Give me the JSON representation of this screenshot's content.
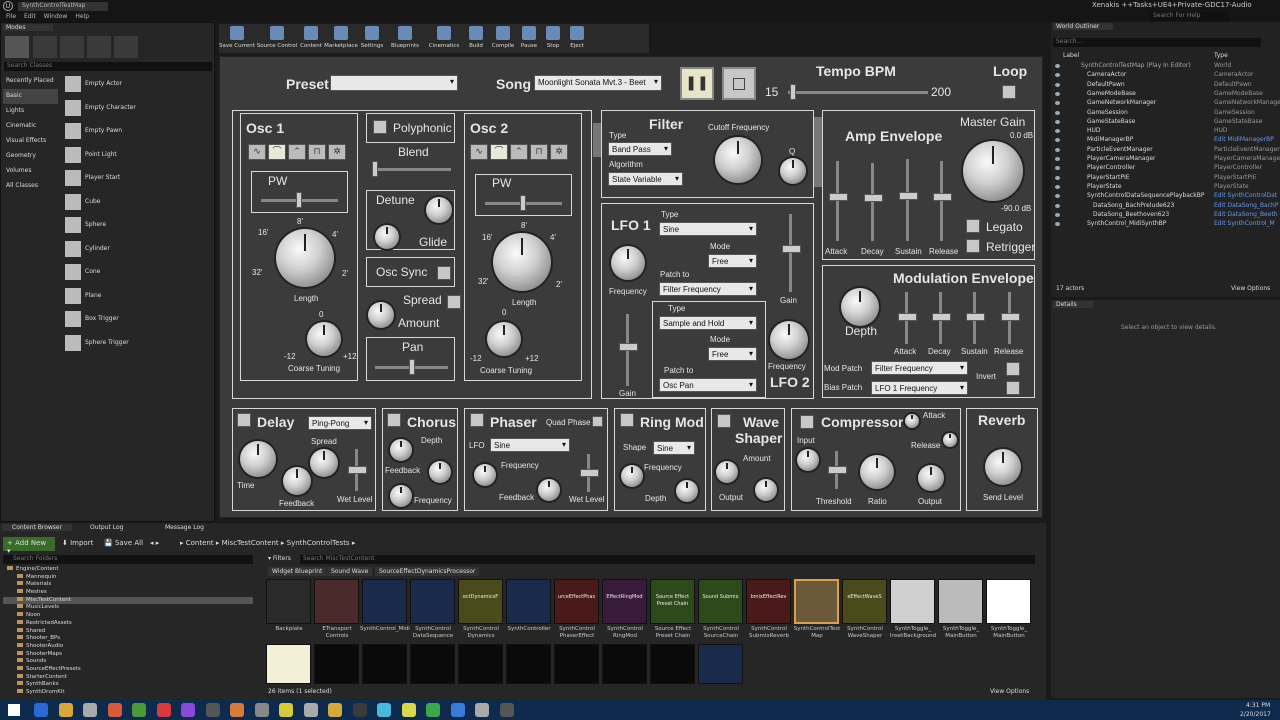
{
  "window": {
    "title": "Xenakis ++Tasks+UE4+Private-GDC17-Audio",
    "search_help": "Search For Help",
    "menu": [
      "File",
      "Edit",
      "Window",
      "Help"
    ],
    "tab": "SynthControlTestMap"
  },
  "modes": {
    "tab": "Modes",
    "search_placeholder": "Search Classes",
    "categories": [
      "Recently Placed",
      "Basic",
      "Lights",
      "Cinematic",
      "Visual Effects",
      "Geometry",
      "Volumes",
      "All Classes"
    ],
    "items": [
      "Empty Actor",
      "Empty Character",
      "Empty Pawn",
      "Point Light",
      "Player Start",
      "Cube",
      "Sphere",
      "Cylinder",
      "Cone",
      "Plane",
      "Box Trigger",
      "Sphere Trigger"
    ]
  },
  "toolbar": {
    "buttons": [
      "Save Current",
      "Source Control",
      "Content",
      "Marketplace",
      "Settings",
      "Blueprints",
      "Cinematics",
      "Build",
      "Compile",
      "Pause",
      "Stop",
      "Eject"
    ]
  },
  "synth": {
    "preset_label": "Preset",
    "preset_value": "",
    "song_label": "Song",
    "song_value": "Moonlight Sonata Mvt.3 - Beet",
    "tempo_label": "Tempo BPM",
    "tempo_min": "15",
    "tempo_max": "200",
    "loop_label": "Loop",
    "osc1": {
      "title": "Osc 1",
      "pw": "PW",
      "tick_8": "8'",
      "tick_16": "16'",
      "tick_4": "4'",
      "tick_32": "32'",
      "tick_2": "2'",
      "length": "Length",
      "zero": "0",
      "neg12": "-12",
      "pos12": "+12",
      "coarse": "Coarse Tuning"
    },
    "poly": {
      "polyphonic": "Polyphonic",
      "blend": "Blend",
      "detune": "Detune",
      "glide": "Glide",
      "osc_sync": "Osc Sync",
      "spread": "Spread",
      "amount": "Amount",
      "pan": "Pan"
    },
    "osc2": {
      "title": "Osc 2",
      "pw": "PW",
      "tick_8": "8'",
      "tick_16": "16'",
      "tick_4": "4'",
      "tick_32": "32'",
      "tick_2": "2'",
      "length": "Length",
      "zero": "0",
      "neg12": "-12",
      "pos12": "+12",
      "coarse": "Coarse Tuning"
    },
    "filter": {
      "title": "Filter",
      "type_label": "Type",
      "type_value": "Band Pass",
      "algo_label": "Algorithm",
      "algo_value": "State Variable",
      "cutoff": "Cutoff Frequency",
      "q": "Q"
    },
    "lfo1": {
      "title": "LFO 1",
      "type_label": "Type",
      "type_value": "Sine",
      "mode_label": "Mode",
      "mode_value": "Free",
      "frequency": "Frequency",
      "patch_label": "Patch to",
      "patch_value": "Filter Frequency",
      "gain": "Gain"
    },
    "lfo2": {
      "title": "LFO 2",
      "type_label": "Type",
      "type_value": "Sample and Hold",
      "mode_label": "Mode",
      "mode_value": "Free",
      "patch_label": "Patch to",
      "patch_value": "Osc Pan",
      "frequency": "Frequency",
      "gain": "Gain"
    },
    "amp": {
      "title": "Amp Envelope",
      "master": "Master Gain",
      "db_top": "0.0 dB",
      "db_bottom": "-90.0 dB",
      "legato": "Legato",
      "retrigger": "Retrigger",
      "attack": "Attack",
      "decay": "Decay",
      "sustain": "Sustain",
      "release": "Release"
    },
    "mod": {
      "title": "Modulation Envelope",
      "depth": "Depth",
      "attack": "Attack",
      "decay": "Decay",
      "sustain": "Sustain",
      "release": "Release",
      "mod_patch_label": "Mod Patch",
      "mod_patch_value": "Filter Frequency",
      "bias_patch_label": "Bias Patch",
      "bias_patch_value": "LFO 1 Frequency",
      "invert": "Invert"
    },
    "delay": {
      "title": "Delay",
      "mode_value": "Ping-Pong",
      "time": "Time",
      "feedback": "Feedback",
      "spread": "Spread",
      "wet": "Wet Level"
    },
    "chorus": {
      "title": "Chorus",
      "depth": "Depth",
      "feedback": "Feedback",
      "frequency": "Frequency"
    },
    "phaser": {
      "title": "Phaser",
      "quad": "Quad Phase",
      "lfo_label": "LFO",
      "lfo_value": "Sine",
      "frequency": "Frequency",
      "feedback": "Feedback",
      "wet": "Wet Level"
    },
    "ringmod": {
      "title": "Ring Mod",
      "shape_label": "Shape",
      "shape_value": "Sine",
      "frequency": "Frequency",
      "depth": "Depth"
    },
    "waveshaper": {
      "title1": "Wave",
      "title2": "Shaper",
      "amount": "Amount",
      "output": "Output"
    },
    "compressor": {
      "title": "Compressor",
      "input": "Input",
      "threshold": "Threshold",
      "ratio": "Ratio",
      "attack": "Attack",
      "release": "Release",
      "output": "Output"
    },
    "reverb": {
      "title": "Reverb",
      "send": "Send Level"
    }
  },
  "outliner": {
    "tab": "World Outliner",
    "search_placeholder": "Search...",
    "col_label": "Label",
    "col_type": "Type",
    "rows": [
      {
        "n": "SynthControlTestMap (Play In Editor)",
        "t": "World"
      },
      {
        "n": "CameraActor",
        "t": "CameraActor"
      },
      {
        "n": "DefaultPawn",
        "t": "DefaultPawn"
      },
      {
        "n": "GameModeBase",
        "t": "GameModeBase"
      },
      {
        "n": "GameNetworkManager",
        "t": "GameNetworkManager"
      },
      {
        "n": "GameSession",
        "t": "GameSession"
      },
      {
        "n": "GameStateBase",
        "t": "GameStateBase"
      },
      {
        "n": "HUD",
        "t": "HUD"
      },
      {
        "n": "MidiManagerBP",
        "t": "Edit MidiManagerBP"
      },
      {
        "n": "ParticleEventManager",
        "t": "ParticleEventManager"
      },
      {
        "n": "PlayerCameraManager",
        "t": "PlayerCameraManager"
      },
      {
        "n": "PlayerController",
        "t": "PlayerController"
      },
      {
        "n": "PlayerStartPIE",
        "t": "PlayerStartPIE"
      },
      {
        "n": "PlayerState",
        "t": "PlayerState"
      },
      {
        "n": "SynthControlDataSequencePlaybackBP",
        "t": "Edit SynthControlDat"
      },
      {
        "n": "DataSong_BachPrelude623",
        "t": "Edit DataSong_BachP"
      },
      {
        "n": "DataSong_Beethoven623",
        "t": "Edit DataSong_Beeth"
      },
      {
        "n": "SynthControl_MidiSynthBP",
        "t": "Edit SynthControl_M"
      }
    ],
    "count": "17 actors",
    "view_options": "View Options"
  },
  "details": {
    "tab": "Details",
    "empty": "Select an object to view details."
  },
  "content": {
    "tabs": [
      "Content Browser",
      "Output Log",
      "Message Log"
    ],
    "add_new": "Add New",
    "import": "Import",
    "save_all": "Save All",
    "path": [
      "Content",
      "MiscTestContent",
      "SynthControlTests"
    ],
    "search_folders": "Search Folders",
    "search_content": "Search MiscTestContent",
    "filters": "Filters",
    "filter_chips": [
      "Widget Blueprint",
      "Sound Wave",
      "SourceEffectDynamicsProcessor"
    ],
    "folders": [
      "Engine/Content",
      "Mannequin",
      "Materials",
      "Meshes",
      "MiscTestContent",
      "MusicLevels",
      "Noon",
      "RestrictedAssets",
      "Shared",
      "Shooter_BPs",
      "ShooterAudio",
      "ShooterMaps",
      "Sounds",
      "SourceEffectPresets",
      "StarterContent",
      "SynthBanks",
      "SynthDrumKit"
    ],
    "assets": [
      {
        "label": "Backplate",
        "inner": "",
        "color": "#2a2a2a"
      },
      {
        "label": "ETransport Controls",
        "inner": "",
        "color": "#4a2a2a"
      },
      {
        "label": "SynthControl_MidiSynthBP",
        "inner": "",
        "color": "#1a2a4a"
      },
      {
        "label": "SynthControl DataSequence PlaybackBP",
        "inner": "",
        "color": "#1a2a4a"
      },
      {
        "label": "SynthControl Dynamics",
        "inner": "ectDynamicsF",
        "color": "#4a4a1a"
      },
      {
        "label": "SynthController",
        "inner": "",
        "color": "#1a2a4a"
      },
      {
        "label": "SynthControl PhaserEffect",
        "inner": "urceEffectPhas",
        "color": "#4a1a1a"
      },
      {
        "label": "SynthControl RingMod",
        "inner": "EffectRingMod",
        "color": "#3a1a3a"
      },
      {
        "label": "Source Effect Preset Chain",
        "inner": "Source Effect Preset Chain",
        "color": "#2e4a1a"
      },
      {
        "label": "SynthControl SourceChain",
        "inner": "Sound Submix",
        "color": "#2e4a1a"
      },
      {
        "label": "SynthControl SubmixReverb",
        "inner": "bmixEffectRev",
        "color": "#4a1a1a"
      },
      {
        "label": "SynthControlTest Map",
        "inner": "",
        "color": "#6a5a3a"
      },
      {
        "label": "SynthControl WaveShaper",
        "inner": "eEffectWaveS",
        "color": "#4a4a1a"
      },
      {
        "label": "SynthToggle_ InsetBackground",
        "inner": "",
        "color": "#d0d0d0"
      },
      {
        "label": "SynthToggle_ MainButton Pressed",
        "inner": "",
        "color": "#bbbbbb"
      },
      {
        "label": "SynthToggle_ MainButton Hovered",
        "inner": "",
        "color": "#ffffff"
      }
    ],
    "status": "26 items (1 selected)",
    "view_options": "View Options"
  },
  "taskbar": {
    "time": "4:31 PM",
    "date": "2/20/2017"
  }
}
